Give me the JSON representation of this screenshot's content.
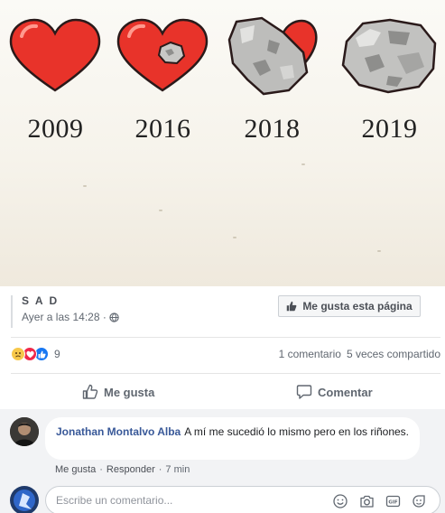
{
  "meme": {
    "panels": [
      {
        "year": "2009",
        "icon": "heart-icon"
      },
      {
        "year": "2016",
        "icon": "heart-with-small-stone-icon"
      },
      {
        "year": "2018",
        "icon": "heart-half-stone-icon"
      },
      {
        "year": "2019",
        "icon": "stone-icon"
      }
    ]
  },
  "post": {
    "page_name": "S A D",
    "timestamp": "Ayer a las 14:28 ·",
    "privacy_icon": "globe-icon",
    "like_page_label": "Me gusta esta página"
  },
  "reactions": {
    "icons": [
      "sad-reaction-icon",
      "love-reaction-icon",
      "like-reaction-icon"
    ],
    "count": "9",
    "comments": "1 comentario",
    "shares": "5 veces compartido"
  },
  "actions": {
    "like_label": "Me gusta",
    "comment_label": "Comentar"
  },
  "comment": {
    "author": "Jonathan Montalvo Alba",
    "text": "A mí me sucedió lo mismo pero en los riñones.",
    "like_link": "Me gusta",
    "separator": "·",
    "reply_link": "Responder",
    "time": "7 min"
  },
  "composer": {
    "placeholder": "Escribe un comentario...",
    "icons": [
      "emoji-icon",
      "camera-icon",
      "gif-icon",
      "sticker-icon"
    ]
  },
  "colors": {
    "heart_red": "#e8332a",
    "stone_gray": "#b9b9b7",
    "link_blue": "#385898",
    "like_blue": "#1877f2",
    "love_red": "#f0284a",
    "sad_yellow": "#f7c84a"
  }
}
